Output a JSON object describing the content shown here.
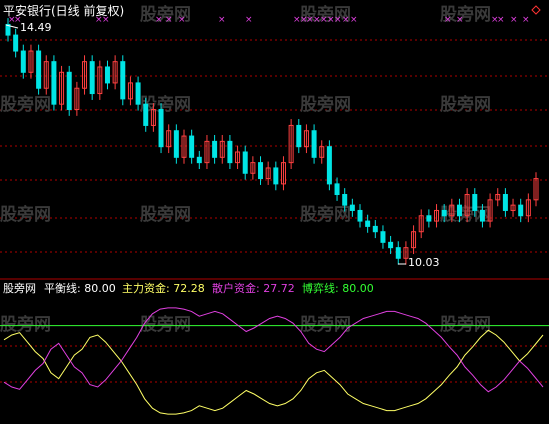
{
  "chart_title": "平安银行(日线 前复权)",
  "watermark": "股旁网",
  "price_panel": {
    "high_label": "14.49",
    "low_label": "10.03",
    "marker_symbol": "×",
    "gridline_color": "#b00000"
  },
  "indicator_panel": {
    "source_label": "股旁网",
    "balance_label": "平衡线: 80.00",
    "main_label": "主力资金: 72.28",
    "retail_label": "散户资金: 27.72",
    "game_label": "博弈线: 80.00",
    "colors": {
      "main": "#ffff66",
      "retail": "#e040e0",
      "game": "#33ff33",
      "text": "#ffffff"
    }
  },
  "chart_data": {
    "type": "candlestick",
    "price": {
      "high": 14.49,
      "low": 10.03,
      "up_color": "#ff4040",
      "down_color": "#00e5e5",
      "closes": [
        14.3,
        14.0,
        13.6,
        14.0,
        13.3,
        13.8,
        13.0,
        13.6,
        12.9,
        13.3,
        13.8,
        13.2,
        13.7,
        13.4,
        13.8,
        13.1,
        13.4,
        13.0,
        12.6,
        12.9,
        12.2,
        12.5,
        12.0,
        12.4,
        12.0,
        11.9,
        12.3,
        12.0,
        12.3,
        11.9,
        12.1,
        11.7,
        11.9,
        11.6,
        11.8,
        11.5,
        11.9,
        12.6,
        12.2,
        12.5,
        12.0,
        12.2,
        11.5,
        11.3,
        11.1,
        11.0,
        10.8,
        10.7,
        10.6,
        10.4,
        10.3,
        10.1,
        10.3,
        10.6,
        10.9,
        10.8,
        11.0,
        10.9,
        11.1,
        10.9,
        11.3,
        11.0,
        10.8,
        11.2,
        11.3,
        11.0,
        11.1,
        10.9,
        11.2,
        11.6
      ]
    },
    "indicator": {
      "ylim": [
        0,
        100
      ],
      "balance_level": 80.0,
      "main": [
        68,
        72,
        74,
        66,
        58,
        52,
        40,
        35,
        45,
        55,
        60,
        70,
        72,
        66,
        58,
        50,
        40,
        30,
        18,
        10,
        6,
        5,
        5,
        6,
        8,
        12,
        10,
        8,
        10,
        15,
        20,
        25,
        22,
        18,
        14,
        12,
        14,
        18,
        25,
        35,
        40,
        42,
        36,
        30,
        22,
        18,
        14,
        12,
        10,
        8,
        8,
        10,
        12,
        14,
        18,
        24,
        30,
        38,
        45,
        55,
        62,
        70,
        76,
        72,
        66,
        58,
        50,
        56,
        64,
        72
      ],
      "retail": [
        32,
        28,
        26,
        34,
        42,
        48,
        60,
        65,
        55,
        45,
        40,
        30,
        28,
        34,
        42,
        50,
        60,
        70,
        82,
        90,
        94,
        95,
        95,
        94,
        92,
        88,
        90,
        92,
        90,
        85,
        80,
        75,
        78,
        82,
        86,
        88,
        86,
        82,
        75,
        65,
        60,
        58,
        64,
        70,
        78,
        82,
        86,
        88,
        90,
        92,
        92,
        90,
        88,
        86,
        82,
        76,
        70,
        62,
        55,
        45,
        38,
        30,
        24,
        28,
        34,
        42,
        50,
        44,
        36,
        28
      ]
    }
  }
}
